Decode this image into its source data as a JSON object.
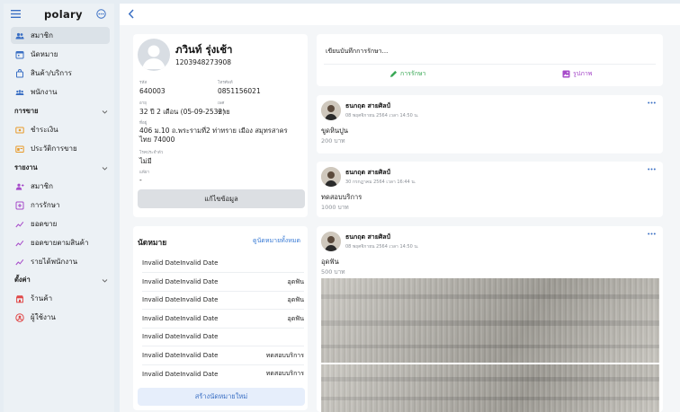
{
  "app": {
    "logo": "polary"
  },
  "sidebar": {
    "items": [
      {
        "label": "สมาชิก",
        "icon": "members-icon"
      },
      {
        "label": "นัดหมาย",
        "icon": "calendar-icon"
      },
      {
        "label": "สินค้า/บริการ",
        "icon": "bag-icon"
      },
      {
        "label": "พนักงาน",
        "icon": "staff-icon"
      }
    ],
    "sections": [
      {
        "label": "การขาย",
        "items": [
          {
            "label": "ชำระเงิน",
            "icon": "payment-icon"
          },
          {
            "label": "ประวัติการขาย",
            "icon": "sales-history-icon"
          }
        ]
      },
      {
        "label": "รายงาน",
        "items": [
          {
            "label": "สมาชิก",
            "icon": "members-report-icon"
          },
          {
            "label": "การรักษา",
            "icon": "treatment-icon"
          },
          {
            "label": "ยอดขาย",
            "icon": "chart-line-icon"
          },
          {
            "label": "ยอดขายตามสินค้า",
            "icon": "chart-line-icon"
          },
          {
            "label": "รายได้พนักงาน",
            "icon": "chart-line-icon"
          }
        ]
      },
      {
        "label": "ตั้งค่า",
        "items": [
          {
            "label": "ร้านค้า",
            "icon": "store-icon"
          },
          {
            "label": "ผู้ใช้งาน",
            "icon": "user-circle-icon"
          }
        ]
      }
    ]
  },
  "profile": {
    "name": "ภวินท์ รุ่งเช้า",
    "id": "1203948273908",
    "fields": {
      "code_label": "รหัส",
      "code": "640003",
      "phone_label": "โทรศัพท์",
      "phone": "0851156021",
      "age_label": "อายุ",
      "age": "32 ปี 2 เดือน (05-09-2532)",
      "gender_label": "เพศ",
      "gender": "ชาย",
      "address_label": "ที่อยู่",
      "address": "406 ม.10 ถ.พระรามที่2 ท่าทราย เมือง สมุทรสาครไทย 74000",
      "disease_label": "โรคประจำตัว",
      "disease": "ไม่มี",
      "allergy_label": "แพ้ยา",
      "allergy": "-"
    },
    "edit_button": "แก้ไขข้อมูล"
  },
  "appointments": {
    "title": "นัดหมาย",
    "view_all": "ดูนัดหมายทั้งหมด",
    "rows": [
      {
        "date": "Invalid DateInvalid Date",
        "service": ""
      },
      {
        "date": "Invalid DateInvalid Date",
        "service": "อุดฟัน"
      },
      {
        "date": "Invalid DateInvalid Date",
        "service": "อุดฟัน"
      },
      {
        "date": "Invalid DateInvalid Date",
        "service": "อุดฟัน"
      },
      {
        "date": "Invalid DateInvalid Date",
        "service": ""
      },
      {
        "date": "Invalid DateInvalid Date",
        "service": "ทดสอบบริการ"
      },
      {
        "date": "Invalid DateInvalid Date",
        "service": "ทดสอบบริการ"
      }
    ],
    "new_button": "สร้างนัดหมายใหม่"
  },
  "compose": {
    "placeholder": "เขียนบันทึกการรักษา...",
    "treatment_label": "การรักษา",
    "photo_label": "รูปภาพ",
    "treatment_color": "#3aa856",
    "photo_color": "#a64ac9"
  },
  "posts": [
    {
      "author": "ธนกฤต สายศิลป์",
      "time": "08 พฤศจิกายน 2564 เวลา 14:50 น.",
      "service": "ขูดหินปูน",
      "price": "200 บาท"
    },
    {
      "author": "ธนกฤต สายศิลป์",
      "time": "30 กรกฎาคม 2564 เวลา 16:44 น.",
      "service": "ทดสอบบริการ",
      "price": "1000 บาท"
    },
    {
      "author": "ธนกฤต สายศิลป์",
      "time": "08 พฤศจิกายน 2564 เวลา 14:50 น.",
      "service": "อุดฟัน",
      "price": "500 บาท"
    }
  ],
  "colors": {
    "accent": "#3a7bd5",
    "sidebar_bg": "#ecf1f5",
    "active_bg": "#dbe2e8"
  }
}
